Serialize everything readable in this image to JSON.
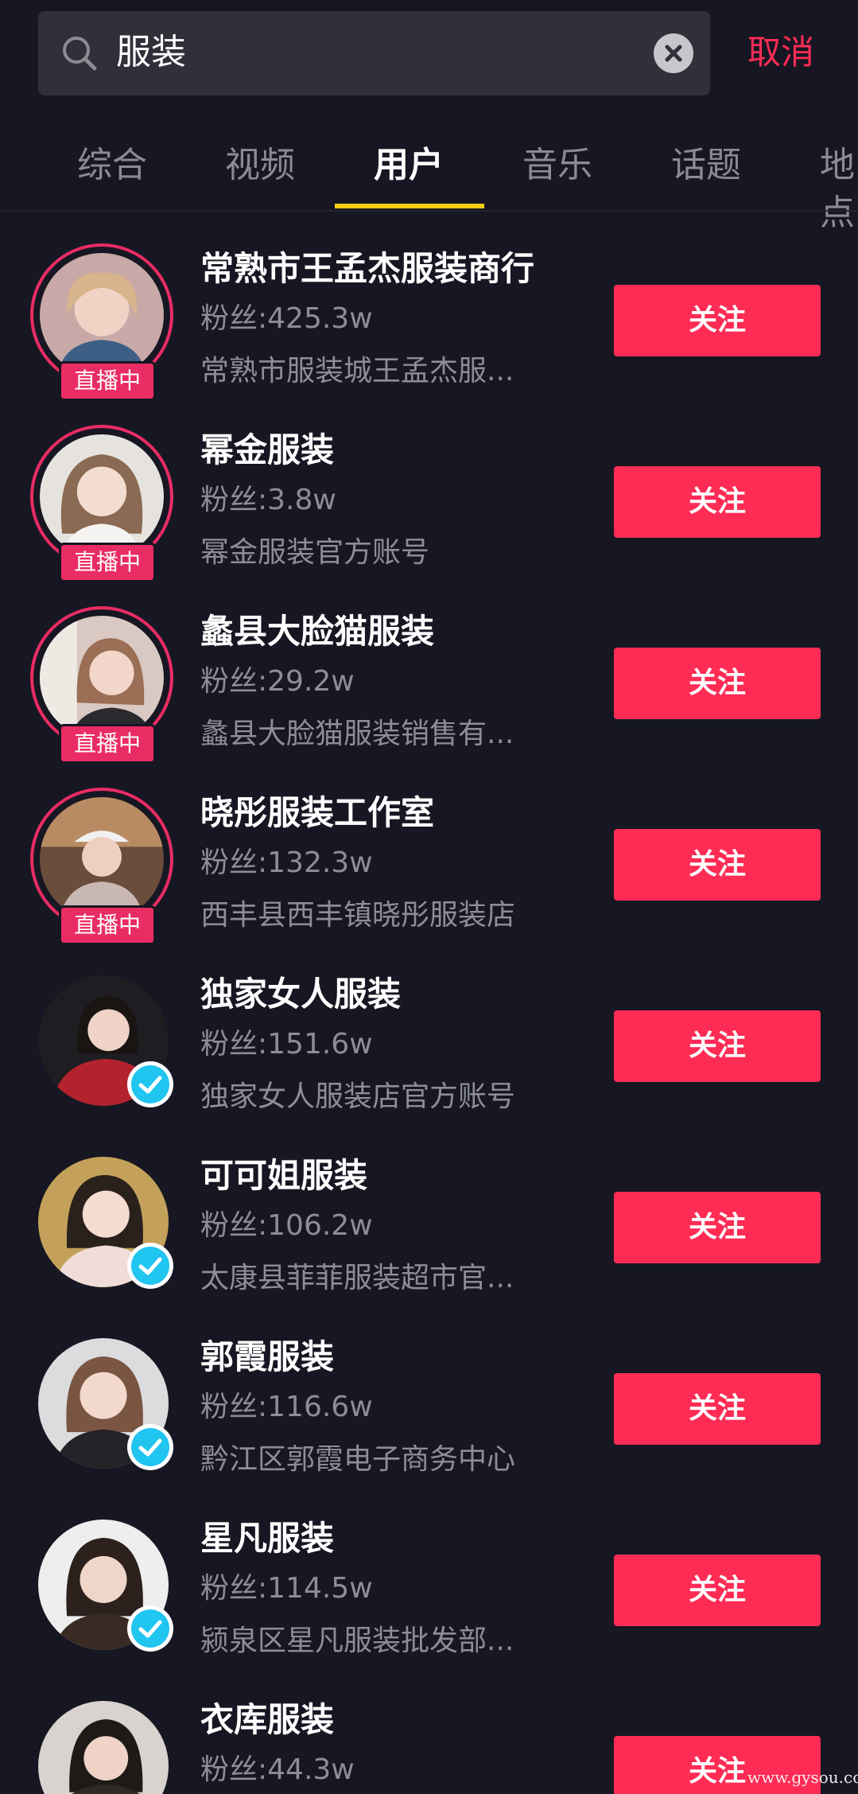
{
  "search": {
    "query": "服装",
    "cancel_label": "取消"
  },
  "tabs": [
    {
      "label": "综合"
    },
    {
      "label": "视频"
    },
    {
      "label": "用户",
      "active": true
    },
    {
      "label": "音乐"
    },
    {
      "label": "话题"
    },
    {
      "label": "地点"
    }
  ],
  "users": [
    {
      "name": "常熟市王孟杰服装商行",
      "fans": "粉丝:425.3w",
      "desc": "常熟市服装城王孟杰服...",
      "badge": "直播中",
      "follow_label": "关注"
    },
    {
      "name": "幂金服装",
      "fans": "粉丝:3.8w",
      "desc": "幂金服装官方账号",
      "badge": "直播中",
      "follow_label": "关注"
    },
    {
      "name": "蠡县大脸猫服装",
      "fans": "粉丝:29.2w",
      "desc": "蠡县大脸猫服装销售有...",
      "badge": "直播中",
      "follow_label": "关注"
    },
    {
      "name": "晓彤服装工作室",
      "fans": "粉丝:132.3w",
      "desc": "西丰县西丰镇晓彤服装店",
      "badge": "直播中",
      "follow_label": "关注"
    },
    {
      "name": "独家女人服装",
      "fans": "粉丝:151.6w",
      "desc": "独家女人服装店官方账号",
      "verified": true,
      "follow_label": "关注"
    },
    {
      "name": "可可姐服装",
      "fans": "粉丝:106.2w",
      "desc": "太康县菲菲服装超市官...",
      "verified": true,
      "follow_label": "关注"
    },
    {
      "name": "郭霞服装",
      "fans": "粉丝:116.6w",
      "desc": "黔江区郭霞电子商务中心",
      "verified": true,
      "follow_label": "关注"
    },
    {
      "name": "星凡服装",
      "fans": "粉丝:114.5w",
      "desc": "颍泉区星凡服装批发部...",
      "verified": true,
      "follow_label": "关注"
    },
    {
      "name": "衣库服装",
      "fans": "粉丝:44.3w",
      "desc": "",
      "follow_label": "关注"
    }
  ],
  "watermark": "www.gysou.com",
  "colors": {
    "background": "#161722",
    "accent": "#fe2c55",
    "live": "#ea2c64",
    "tab_indicator": "#face15",
    "verified": "#20c5f0"
  }
}
